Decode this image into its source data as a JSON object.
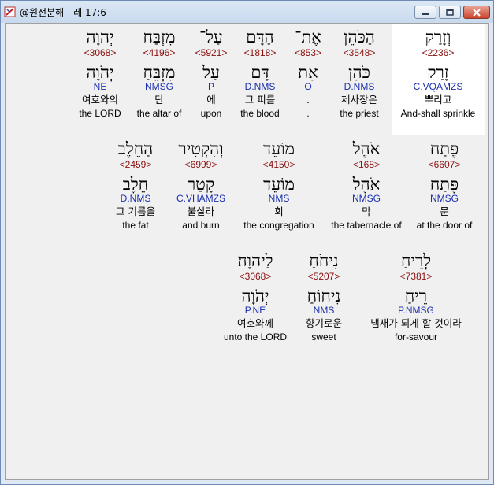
{
  "window": {
    "title": "@원전분해 - 레 17:6",
    "icon": "bible-app-icon",
    "controls": [
      "minimize",
      "maximize",
      "close"
    ]
  },
  "verses": [
    {
      "row": 1,
      "words": [
        {
          "heb": "וְזָרַק",
          "strong": "<2236>",
          "lex": "זָרַק",
          "parse": "C.VQAMZS",
          "kor": "뿌리고",
          "eng": "And-shall sprinkle",
          "selected": true
        },
        {
          "heb": "הַכֹּהֵן",
          "strong": "<3548>",
          "lex": "כֹּהֵן",
          "parse": "D.NMS",
          "kor": "제사장은",
          "eng": "the priest"
        },
        {
          "heb": "אֶת־",
          "strong": "<853>",
          "lex": "אֵת",
          "parse": "O",
          "kor": ".",
          "eng": "."
        },
        {
          "heb": "הַדָּם",
          "strong": "<1818>",
          "lex": "דָּם",
          "parse": "D.NMS",
          "kor": "그 피를",
          "eng": "the blood"
        },
        {
          "heb": "עַל־",
          "strong": "<5921>",
          "lex": "עַל",
          "parse": "P",
          "kor": "에",
          "eng": "upon"
        },
        {
          "heb": "מִזְבַּח",
          "strong": "<4196>",
          "lex": "מִזְבֵּחַ",
          "parse": "NMSG",
          "kor": "단",
          "eng": "the altar of"
        },
        {
          "heb": "יְהוָה",
          "strong": "<3068>",
          "lex": "יְהֹוָה",
          "parse": "NE",
          "kor": "여호와의",
          "eng": "the LORD"
        }
      ]
    },
    {
      "row": 2,
      "words": [
        {
          "heb": "פֶּתַח",
          "strong": "<6607>",
          "lex": "פֶּתַח",
          "parse": "NMSG",
          "kor": "문",
          "eng": "at the door of"
        },
        {
          "heb": "אֹהֶל",
          "strong": "<168>",
          "lex": "אֹהֶל",
          "parse": "NMSG",
          "kor": "막",
          "eng": "the tabernacle of"
        },
        {
          "heb": "מוֹעֵד",
          "strong": "<4150>",
          "lex": "מוֹעֵד",
          "parse": "NMS",
          "kor": "회",
          "eng": "the congregation"
        },
        {
          "heb": "וְהִקְטִיר",
          "strong": "<6999>",
          "lex": "קָטַר",
          "parse": "C.VHAMZS",
          "kor": "불살라",
          "eng": "and burn"
        },
        {
          "heb": "הַחֵלֶב",
          "strong": "<2459>",
          "lex": "חֵלֶב",
          "parse": "D.NMS",
          "kor": "그 기름을",
          "eng": "the fat"
        }
      ]
    },
    {
      "row": 3,
      "words": [
        {
          "heb": "לְרֵיחַ",
          "strong": "<7381>",
          "lex": "רֵיחַ",
          "parse": "P.NMSG",
          "kor": "냄새가 되게 할 것이라",
          "eng": "for-savour"
        },
        {
          "heb": "נִיחֹחַ",
          "strong": "<5207>",
          "lex": "נִיחוֹחַ",
          "parse": "NMS",
          "kor": "향기로운",
          "eng": "sweet"
        },
        {
          "heb": "לַיהוָה׃",
          "strong": "<3068>",
          "lex": "יְהֹוָה",
          "parse": "P.NE",
          "kor": "여호와께",
          "eng": "unto the LORD"
        }
      ]
    }
  ]
}
